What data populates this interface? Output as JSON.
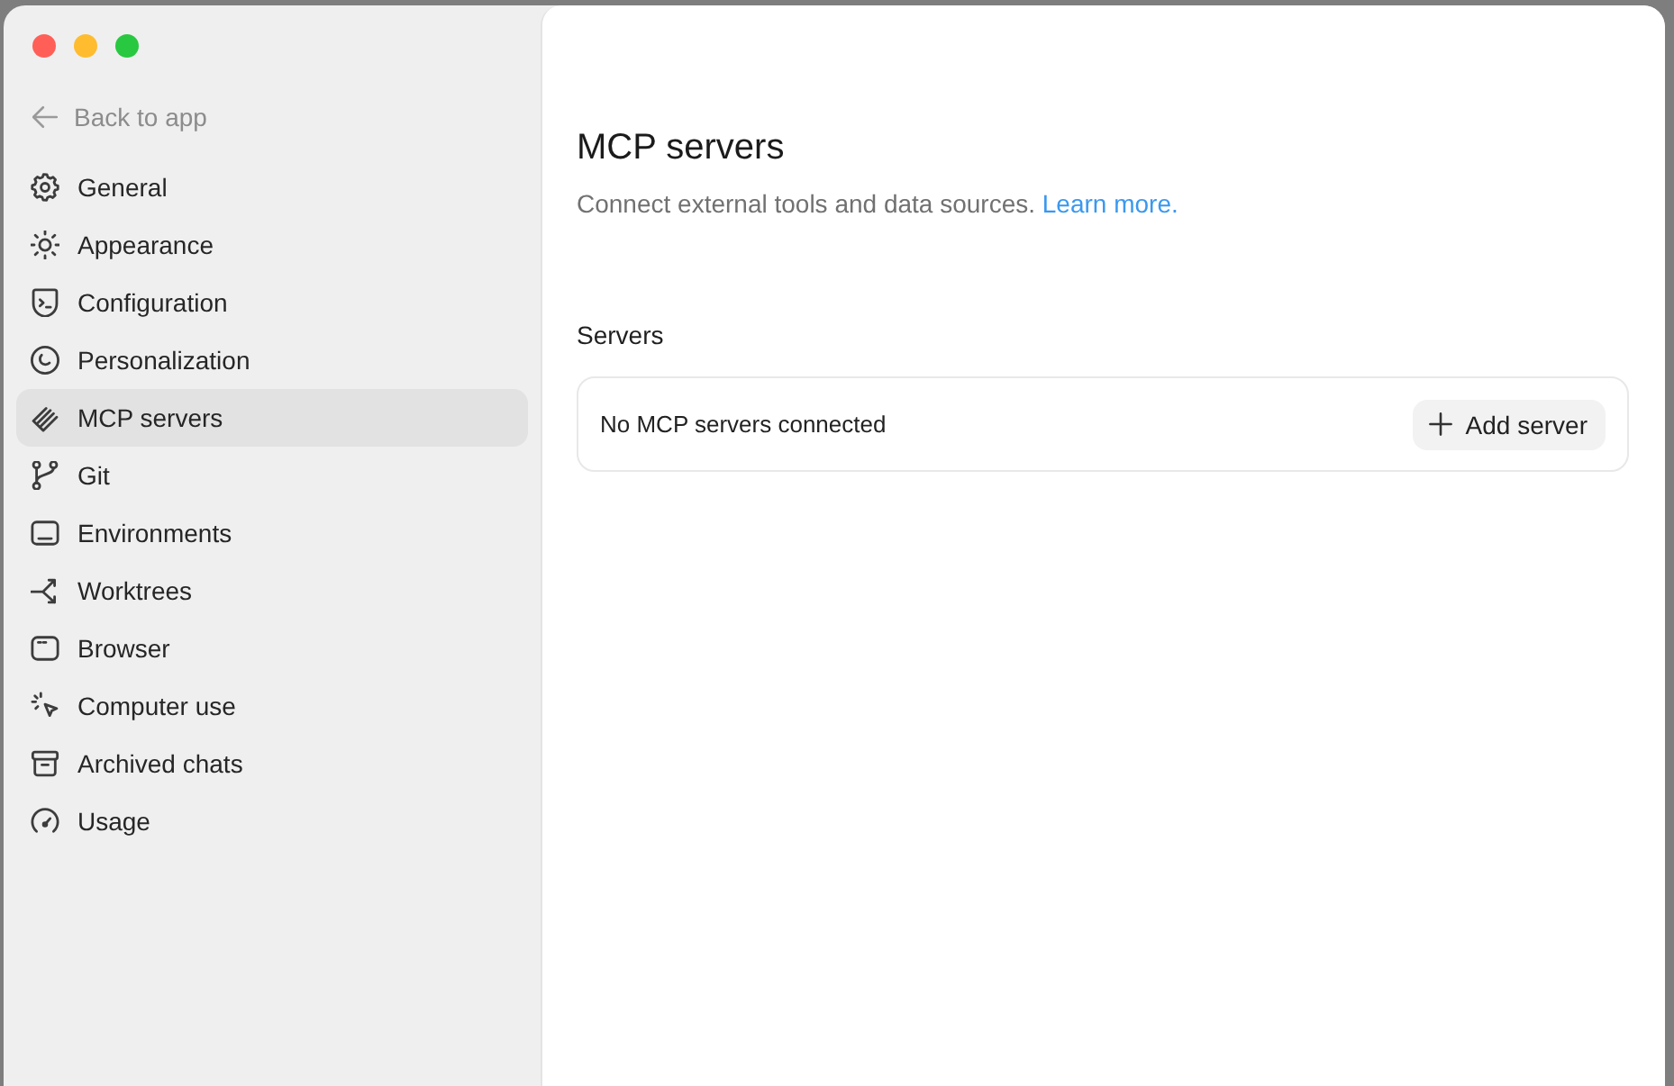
{
  "window": {
    "controls": [
      {
        "color": "#ff5f57"
      },
      {
        "color": "#febc2e"
      },
      {
        "color": "#28c840"
      }
    ]
  },
  "sidebar": {
    "back_link": "Back to app",
    "items": [
      {
        "label": "General",
        "selected": false
      },
      {
        "label": "Appearance",
        "selected": false
      },
      {
        "label": "Configuration",
        "selected": false
      },
      {
        "label": "Personalization",
        "selected": false
      },
      {
        "label": "MCP servers",
        "selected": true
      },
      {
        "label": "Git",
        "selected": false
      },
      {
        "label": "Environments",
        "selected": false
      },
      {
        "label": "Worktrees",
        "selected": false
      },
      {
        "label": "Browser",
        "selected": false
      },
      {
        "label": "Computer use",
        "selected": false
      },
      {
        "label": "Archived chats",
        "selected": false
      },
      {
        "label": "Usage",
        "selected": false
      }
    ]
  },
  "page": {
    "title": "MCP servers",
    "description": "Connect external tools and data sources.",
    "learn_more_link": "Learn more.",
    "section_title": "Servers",
    "servers_card": {
      "empty_message": "No MCP servers connected",
      "add_button": "Add server"
    }
  }
}
